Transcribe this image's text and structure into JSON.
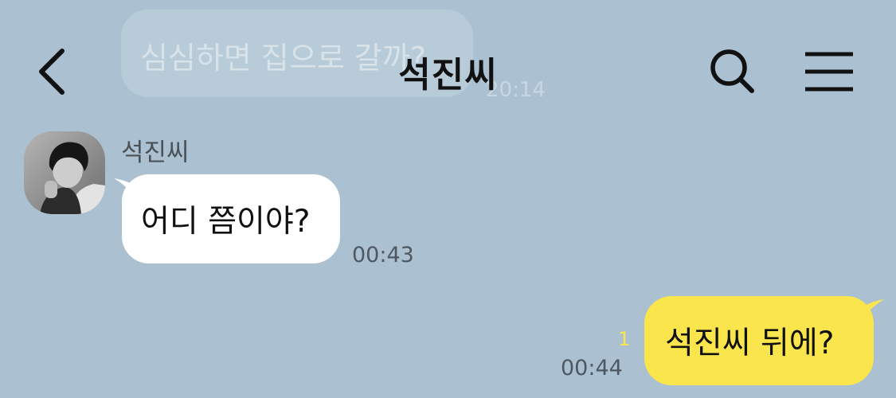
{
  "header": {
    "title": "석진씨",
    "back_icon": "chevron-left-icon",
    "search_icon": "search-icon",
    "menu_icon": "hamburger-menu-icon"
  },
  "faded_message": {
    "text": "심심하면 집으로 갈까?",
    "time": "20:14"
  },
  "messages": [
    {
      "direction": "incoming",
      "sender": "석진씨",
      "text": "어디 쯤이야?",
      "time": "00:43"
    },
    {
      "direction": "outgoing",
      "text": "석진씨 뒤에?",
      "unread": "1",
      "time": "00:44"
    }
  ],
  "colors": {
    "background": "#abc1d1",
    "incoming_bubble": "#ffffff",
    "outgoing_bubble": "#fae64c",
    "unread_count": "#fae64c",
    "timestamp": "#4d5863"
  }
}
